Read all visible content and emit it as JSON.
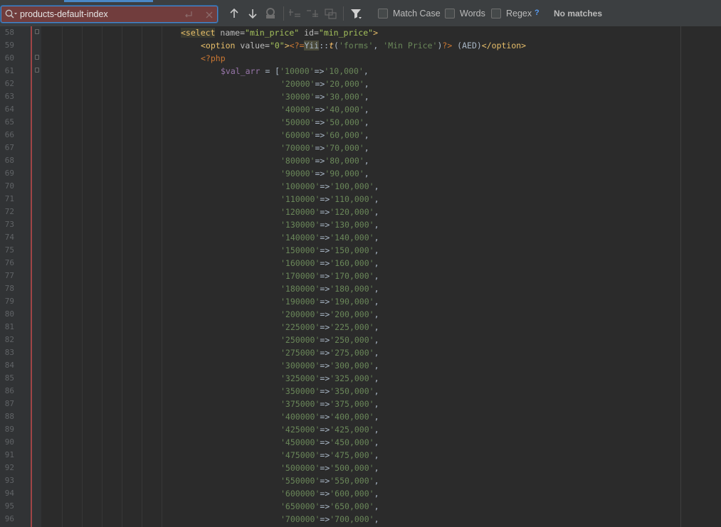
{
  "search": {
    "value": "products-default-index",
    "options": [
      {
        "label": "Match Case",
        "checked": false
      },
      {
        "label": "Words",
        "checked": false
      },
      {
        "label": "Regex",
        "checked": false
      }
    ],
    "help": "?",
    "status": "No matches"
  },
  "icons": {
    "search": "search-history-icon",
    "newline": "new-line-icon",
    "clear": "clear-icon",
    "prev": "previous-occurrence-icon",
    "next": "next-occurrence-icon",
    "find_all": "find-all-icon",
    "add_selection": "add-selection-icon",
    "remove_selection": "remove-selection-icon",
    "select_all": "select-all-occurrences-icon",
    "filter": "filter-icon"
  },
  "colors": {
    "background": "#2b2b2b",
    "search_field_no_match": "#713d3d",
    "focus": "#4a88c7",
    "tag": "#e8bf6a",
    "string": "#6a8759",
    "variable": "#9876aa",
    "keyword": "#cc7832"
  },
  "editor": {
    "lines": [
      {
        "num": "58",
        "fold": true,
        "indent": 28,
        "tokens": [
          [
            "tag-hl",
            "<select"
          ],
          [
            "attr",
            " name="
          ],
          [
            "aval",
            "\"min_price\""
          ],
          [
            "attr",
            " id="
          ],
          [
            "aval",
            "\"min_price\""
          ],
          [
            "tag",
            ">"
          ]
        ]
      },
      {
        "num": "59",
        "fold": false,
        "indent": 32,
        "tokens": [
          [
            "tag",
            "<option"
          ],
          [
            "attr",
            " value="
          ],
          [
            "aval",
            "\"0\""
          ],
          [
            "tag",
            ">"
          ],
          [
            "php",
            "<?="
          ],
          [
            "cls",
            "Yii"
          ],
          [
            "plain",
            "::"
          ],
          [
            "fn",
            "t"
          ],
          [
            "plain",
            "("
          ],
          [
            "str",
            "'forms'"
          ],
          [
            "plain",
            ", "
          ],
          [
            "str",
            "'Min Price'"
          ],
          [
            "plain",
            ")"
          ],
          [
            "php",
            "?>"
          ],
          [
            "plain",
            " (AED)"
          ],
          [
            "tag",
            "</option>"
          ]
        ]
      },
      {
        "num": "60",
        "fold": true,
        "indent": 32,
        "tokens": [
          [
            "php",
            "<?php"
          ]
        ]
      },
      {
        "num": "61",
        "fold": true,
        "indent": 36,
        "tokens": [
          [
            "var",
            "$val_arr"
          ],
          [
            "plain",
            " = ["
          ],
          [
            "str",
            "'10000'"
          ],
          [
            "plain",
            "=>"
          ],
          [
            "str",
            "'10,000'"
          ],
          [
            "plain",
            ","
          ]
        ]
      },
      {
        "num": "62",
        "fold": false,
        "indent": 48,
        "tokens": [
          [
            "str",
            "'20000'"
          ],
          [
            "plain",
            "=>"
          ],
          [
            "str",
            "'20,000'"
          ],
          [
            "plain",
            ","
          ]
        ]
      },
      {
        "num": "63",
        "fold": false,
        "indent": 48,
        "tokens": [
          [
            "str",
            "'30000'"
          ],
          [
            "plain",
            "=>"
          ],
          [
            "str",
            "'30,000'"
          ],
          [
            "plain",
            ","
          ]
        ]
      },
      {
        "num": "64",
        "fold": false,
        "indent": 48,
        "tokens": [
          [
            "str",
            "'40000'"
          ],
          [
            "plain",
            "=>"
          ],
          [
            "str",
            "'40,000'"
          ],
          [
            "plain",
            ","
          ]
        ]
      },
      {
        "num": "65",
        "fold": false,
        "indent": 48,
        "tokens": [
          [
            "str",
            "'50000'"
          ],
          [
            "plain",
            "=>"
          ],
          [
            "str",
            "'50,000'"
          ],
          [
            "plain",
            ","
          ]
        ]
      },
      {
        "num": "66",
        "fold": false,
        "indent": 48,
        "tokens": [
          [
            "str",
            "'60000'"
          ],
          [
            "plain",
            "=>"
          ],
          [
            "str",
            "'60,000'"
          ],
          [
            "plain",
            ","
          ]
        ]
      },
      {
        "num": "67",
        "fold": false,
        "indent": 48,
        "tokens": [
          [
            "str",
            "'70000'"
          ],
          [
            "plain",
            "=>"
          ],
          [
            "str",
            "'70,000'"
          ],
          [
            "plain",
            ","
          ]
        ]
      },
      {
        "num": "68",
        "fold": false,
        "indent": 48,
        "tokens": [
          [
            "str",
            "'80000'"
          ],
          [
            "plain",
            "=>"
          ],
          [
            "str",
            "'80,000'"
          ],
          [
            "plain",
            ","
          ]
        ]
      },
      {
        "num": "69",
        "fold": false,
        "indent": 48,
        "tokens": [
          [
            "str",
            "'90000'"
          ],
          [
            "plain",
            "=>"
          ],
          [
            "str",
            "'90,000'"
          ],
          [
            "plain",
            ","
          ]
        ]
      },
      {
        "num": "70",
        "fold": false,
        "indent": 48,
        "tokens": [
          [
            "str",
            "'100000'"
          ],
          [
            "plain",
            "=>"
          ],
          [
            "str",
            "'100,000'"
          ],
          [
            "plain",
            ","
          ]
        ]
      },
      {
        "num": "71",
        "fold": false,
        "indent": 48,
        "tokens": [
          [
            "str",
            "'110000'"
          ],
          [
            "plain",
            "=>"
          ],
          [
            "str",
            "'110,000'"
          ],
          [
            "plain",
            ","
          ]
        ]
      },
      {
        "num": "72",
        "fold": false,
        "indent": 48,
        "tokens": [
          [
            "str",
            "'120000'"
          ],
          [
            "plain",
            "=>"
          ],
          [
            "str",
            "'120,000'"
          ],
          [
            "plain",
            ","
          ]
        ]
      },
      {
        "num": "73",
        "fold": false,
        "indent": 48,
        "tokens": [
          [
            "str",
            "'130000'"
          ],
          [
            "plain",
            "=>"
          ],
          [
            "str",
            "'130,000'"
          ],
          [
            "plain",
            ","
          ]
        ]
      },
      {
        "num": "74",
        "fold": false,
        "indent": 48,
        "tokens": [
          [
            "str",
            "'140000'"
          ],
          [
            "plain",
            "=>"
          ],
          [
            "str",
            "'140,000'"
          ],
          [
            "plain",
            ","
          ]
        ]
      },
      {
        "num": "75",
        "fold": false,
        "indent": 48,
        "tokens": [
          [
            "str",
            "'150000'"
          ],
          [
            "plain",
            "=>"
          ],
          [
            "str",
            "'150,000'"
          ],
          [
            "plain",
            ","
          ]
        ]
      },
      {
        "num": "76",
        "fold": false,
        "indent": 48,
        "tokens": [
          [
            "str",
            "'160000'"
          ],
          [
            "plain",
            "=>"
          ],
          [
            "str",
            "'160,000'"
          ],
          [
            "plain",
            ","
          ]
        ]
      },
      {
        "num": "77",
        "fold": false,
        "indent": 48,
        "tokens": [
          [
            "str",
            "'170000'"
          ],
          [
            "plain",
            "=>"
          ],
          [
            "str",
            "'170,000'"
          ],
          [
            "plain",
            ","
          ]
        ]
      },
      {
        "num": "78",
        "fold": false,
        "indent": 48,
        "tokens": [
          [
            "str",
            "'180000'"
          ],
          [
            "plain",
            "=>"
          ],
          [
            "str",
            "'180,000'"
          ],
          [
            "plain",
            ","
          ]
        ]
      },
      {
        "num": "79",
        "fold": false,
        "indent": 48,
        "tokens": [
          [
            "str",
            "'190000'"
          ],
          [
            "plain",
            "=>"
          ],
          [
            "str",
            "'190,000'"
          ],
          [
            "plain",
            ","
          ]
        ]
      },
      {
        "num": "80",
        "fold": false,
        "indent": 48,
        "tokens": [
          [
            "str",
            "'200000'"
          ],
          [
            "plain",
            "=>"
          ],
          [
            "str",
            "'200,000'"
          ],
          [
            "plain",
            ","
          ]
        ]
      },
      {
        "num": "81",
        "fold": false,
        "indent": 48,
        "tokens": [
          [
            "str",
            "'225000'"
          ],
          [
            "plain",
            "=>"
          ],
          [
            "str",
            "'225,000'"
          ],
          [
            "plain",
            ","
          ]
        ]
      },
      {
        "num": "82",
        "fold": false,
        "indent": 48,
        "tokens": [
          [
            "str",
            "'250000'"
          ],
          [
            "plain",
            "=>"
          ],
          [
            "str",
            "'250,000'"
          ],
          [
            "plain",
            ","
          ]
        ]
      },
      {
        "num": "83",
        "fold": false,
        "indent": 48,
        "tokens": [
          [
            "str",
            "'275000'"
          ],
          [
            "plain",
            "=>"
          ],
          [
            "str",
            "'275,000'"
          ],
          [
            "plain",
            ","
          ]
        ]
      },
      {
        "num": "84",
        "fold": false,
        "indent": 48,
        "tokens": [
          [
            "str",
            "'300000'"
          ],
          [
            "plain",
            "=>"
          ],
          [
            "str",
            "'300,000'"
          ],
          [
            "plain",
            ","
          ]
        ]
      },
      {
        "num": "85",
        "fold": false,
        "indent": 48,
        "tokens": [
          [
            "str",
            "'325000'"
          ],
          [
            "plain",
            "=>"
          ],
          [
            "str",
            "'325,000'"
          ],
          [
            "plain",
            ","
          ]
        ]
      },
      {
        "num": "86",
        "fold": false,
        "indent": 48,
        "tokens": [
          [
            "str",
            "'350000'"
          ],
          [
            "plain",
            "=>"
          ],
          [
            "str",
            "'350,000'"
          ],
          [
            "plain",
            ","
          ]
        ]
      },
      {
        "num": "87",
        "fold": false,
        "indent": 48,
        "tokens": [
          [
            "str",
            "'375000'"
          ],
          [
            "plain",
            "=>"
          ],
          [
            "str",
            "'375,000'"
          ],
          [
            "plain",
            ","
          ]
        ]
      },
      {
        "num": "88",
        "fold": false,
        "indent": 48,
        "tokens": [
          [
            "str",
            "'400000'"
          ],
          [
            "plain",
            "=>"
          ],
          [
            "str",
            "'400,000'"
          ],
          [
            "plain",
            ","
          ]
        ]
      },
      {
        "num": "89",
        "fold": false,
        "indent": 48,
        "tokens": [
          [
            "str",
            "'425000'"
          ],
          [
            "plain",
            "=>"
          ],
          [
            "str",
            "'425,000'"
          ],
          [
            "plain",
            ","
          ]
        ]
      },
      {
        "num": "90",
        "fold": false,
        "indent": 48,
        "tokens": [
          [
            "str",
            "'450000'"
          ],
          [
            "plain",
            "=>"
          ],
          [
            "str",
            "'450,000'"
          ],
          [
            "plain",
            ","
          ]
        ]
      },
      {
        "num": "91",
        "fold": false,
        "indent": 48,
        "tokens": [
          [
            "str",
            "'475000'"
          ],
          [
            "plain",
            "=>"
          ],
          [
            "str",
            "'475,000'"
          ],
          [
            "plain",
            ","
          ]
        ]
      },
      {
        "num": "92",
        "fold": false,
        "indent": 48,
        "tokens": [
          [
            "str",
            "'500000'"
          ],
          [
            "plain",
            "=>"
          ],
          [
            "str",
            "'500,000'"
          ],
          [
            "plain",
            ","
          ]
        ]
      },
      {
        "num": "93",
        "fold": false,
        "indent": 48,
        "tokens": [
          [
            "str",
            "'550000'"
          ],
          [
            "plain",
            "=>"
          ],
          [
            "str",
            "'550,000'"
          ],
          [
            "plain",
            ","
          ]
        ]
      },
      {
        "num": "94",
        "fold": false,
        "indent": 48,
        "tokens": [
          [
            "str",
            "'600000'"
          ],
          [
            "plain",
            "=>"
          ],
          [
            "str",
            "'600,000'"
          ],
          [
            "plain",
            ","
          ]
        ]
      },
      {
        "num": "95",
        "fold": false,
        "indent": 48,
        "tokens": [
          [
            "str",
            "'650000'"
          ],
          [
            "plain",
            "=>"
          ],
          [
            "str",
            "'650,000'"
          ],
          [
            "plain",
            ","
          ]
        ]
      },
      {
        "num": "96",
        "fold": false,
        "indent": 48,
        "tokens": [
          [
            "str",
            "'700000'"
          ],
          [
            "plain",
            "=>"
          ],
          [
            "str",
            "'700,000'"
          ],
          [
            "plain",
            ","
          ]
        ]
      }
    ]
  }
}
